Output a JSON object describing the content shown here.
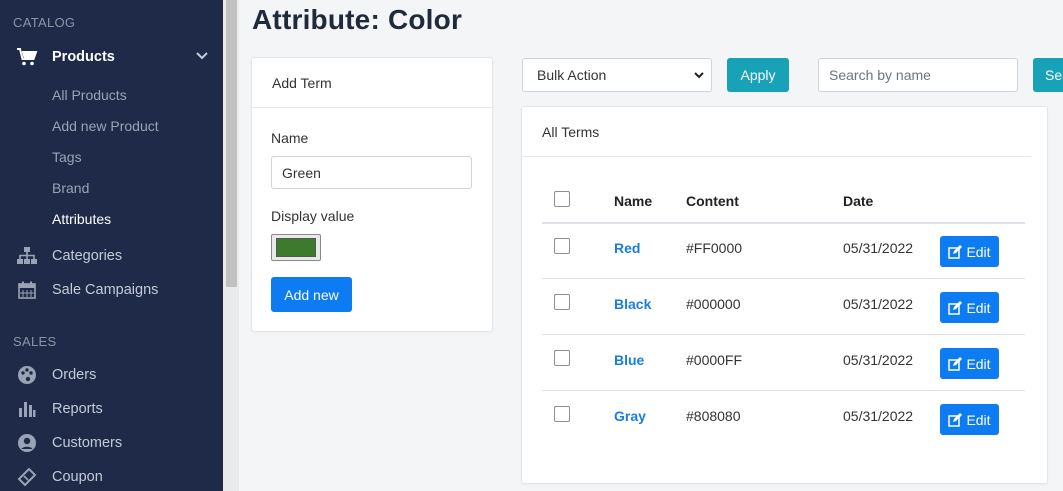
{
  "sidebar": {
    "catalog_title": "CATALOG",
    "sales_title": "SALES",
    "products_label": "Products",
    "products_sub": [
      "All Products",
      "Add new Product",
      "Tags",
      "Brand",
      "Attributes"
    ],
    "categories_label": "Categories",
    "sale_campaigns_label": "Sale Campaigns",
    "orders_label": "Orders",
    "reports_label": "Reports",
    "customers_label": "Customers",
    "coupon_label": "Coupon"
  },
  "page": {
    "title": "Attribute: Color"
  },
  "add_term": {
    "header": "Add Term",
    "name_label": "Name",
    "name_value": "Green",
    "display_value_label": "Display value",
    "display_color": "#3c7a2c",
    "submit_label": "Add new"
  },
  "toolbar": {
    "bulk_action": "Bulk Action",
    "apply_label": "Apply",
    "search_placeholder": "Search by name",
    "search_button_label": "Sea"
  },
  "all_terms": {
    "header": "All Terms",
    "columns": [
      "Name",
      "Content",
      "Date"
    ],
    "edit_label": "Edit",
    "rows": [
      {
        "name": "Red",
        "content": "#FF0000",
        "date": "05/31/2022"
      },
      {
        "name": "Black",
        "content": "#000000",
        "date": "05/31/2022"
      },
      {
        "name": "Blue",
        "content": "#0000FF",
        "date": "05/31/2022"
      },
      {
        "name": "Gray",
        "content": "#808080",
        "date": "05/31/2022"
      }
    ]
  }
}
